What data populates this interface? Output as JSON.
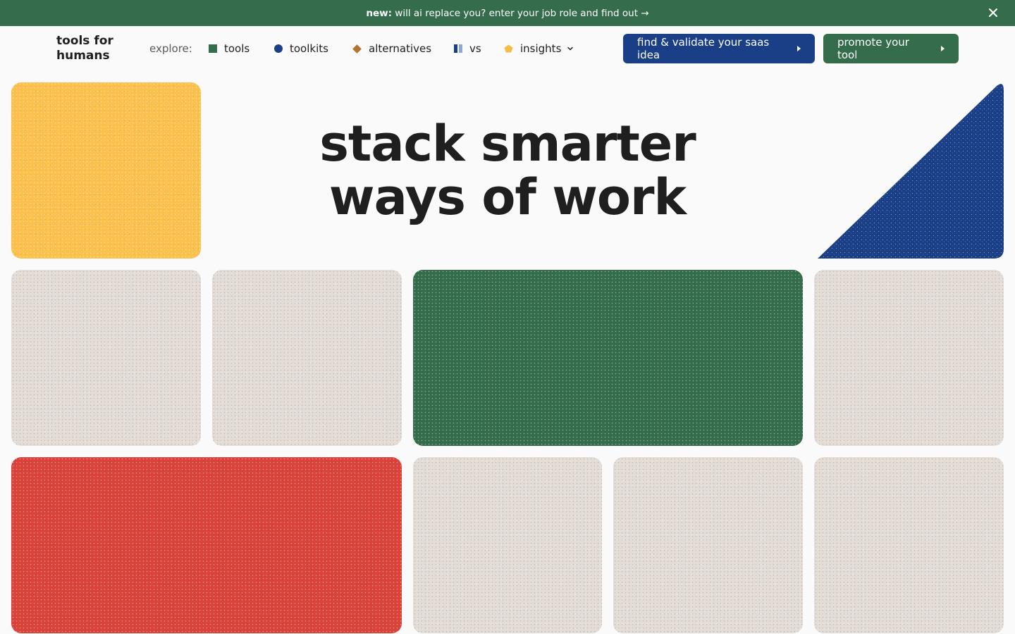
{
  "announcement": {
    "prefix": "new:",
    "text": " will ai replace you? enter your job role and find out →"
  },
  "logo": {
    "line1": "tools for",
    "line2": "humans"
  },
  "nav": {
    "explore_label": "explore:",
    "items": [
      {
        "label": "tools",
        "icon": "square-icon",
        "color": "#356d4c"
      },
      {
        "label": "toolkits",
        "icon": "circle-icon",
        "color": "#1a3f86"
      },
      {
        "label": "alternatives",
        "icon": "diamond-icon",
        "color": "#b27334"
      },
      {
        "label": "vs",
        "icon": "vs-bars-icon",
        "color": "#1a3f86"
      },
      {
        "label": "insights",
        "icon": "pentagon-icon",
        "color": "#f5bd47"
      }
    ]
  },
  "buttons": {
    "validate": "find & validate your saas idea",
    "promote": "promote your tool"
  },
  "hero": {
    "line1": "stack smarter",
    "line2": "ways of work"
  },
  "colors": {
    "green": "#356d4c",
    "blue": "#1a3f86",
    "yellow": "#fcc14d",
    "red": "#d9433a",
    "beige": "#e4ddd7"
  }
}
